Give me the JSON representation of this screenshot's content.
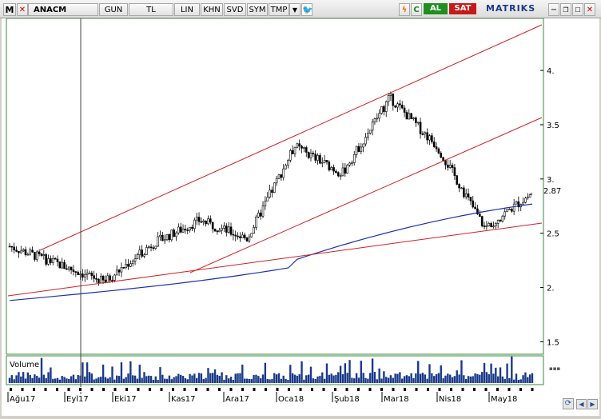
{
  "toolbar": {
    "m_label": "M",
    "symbol": "ANACM",
    "period": "GUN",
    "currency": "TL",
    "scale": "LIN",
    "buttons": [
      "KHN",
      "SVD",
      "SYM",
      "TMP"
    ],
    "al_label": "AL",
    "sat_label": "SAT",
    "brand": "MATRIKS"
  },
  "chart": {
    "last_price_label": "2.87",
    "volume_label": "Volume",
    "y_ticks": [
      {
        "v": 4.0,
        "label": "4."
      },
      {
        "v": 3.5,
        "label": "3.5"
      },
      {
        "v": 3.0,
        "label": "3."
      },
      {
        "v": 2.5,
        "label": "2.5"
      },
      {
        "v": 2.0,
        "label": "2."
      },
      {
        "v": 1.5,
        "label": "1.5"
      }
    ],
    "x_labels": [
      "Ağu17",
      "Eyl17",
      "Eki17",
      "Kas17",
      "Ara17",
      "Oca18",
      "Şub18",
      "Mar18",
      "Nis18",
      "May18"
    ]
  },
  "chart_data": {
    "type": "candlestick",
    "symbol": "ANACM",
    "ylim": [
      1.4,
      4.45
    ],
    "approx_close_path": [
      {
        "date": "Ağu17",
        "close": 2.38
      },
      {
        "date": "Eyl17",
        "close": 2.22
      },
      {
        "date": "Eki17",
        "close": 2.05
      },
      {
        "date": "Kas17",
        "close": 2.4
      },
      {
        "date": "Kas17",
        "close": 2.62
      },
      {
        "date": "Ara17",
        "close": 2.45
      },
      {
        "date": "Oca18",
        "close": 3.3
      },
      {
        "date": "Şub18",
        "close": 3.05
      },
      {
        "date": "Mar18",
        "close": 3.75
      },
      {
        "date": "Nis18",
        "close": 3.3
      },
      {
        "date": "May18",
        "close": 2.55
      },
      {
        "date": "May18",
        "close": 2.87
      }
    ],
    "last_price": 2.87,
    "colors": {
      "trendline": "#d22020",
      "moving_average": "#1a2fb0",
      "candles": "#000000",
      "volume": "#1a3a8a",
      "last_price_box": "#000000"
    }
  }
}
